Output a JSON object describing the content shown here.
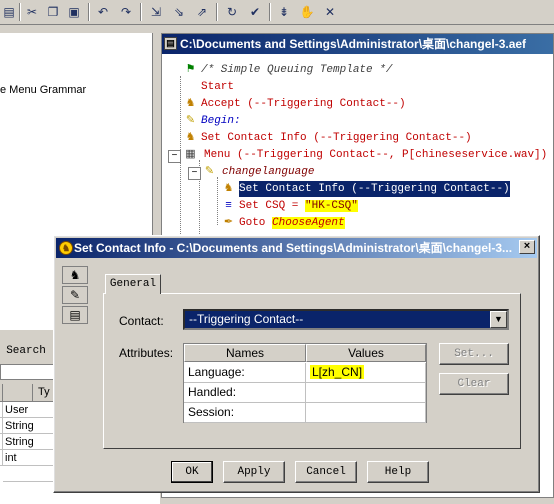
{
  "toolbar": {
    "buttons": [
      "save-icon",
      "cut-icon",
      "copy-icon",
      "paste-icon",
      "undo-icon",
      "redo-icon",
      "step-into-icon",
      "step-over-icon",
      "step-out-icon",
      "run-icon",
      "debug-icon",
      "breakpoint-icon",
      "stop-icon",
      "clear-icon"
    ]
  },
  "left_panel": {
    "grammar_text": "e Menu Grammar",
    "search_label": "Search",
    "table_header_type": "Ty",
    "rows": [
      {
        "value": "User"
      },
      {
        "value": "String"
      },
      {
        "value": "String"
      },
      {
        "value": "int"
      },
      {
        "value": ""
      }
    ]
  },
  "script_window": {
    "title": "C:\\Documents and Settings\\Administrator\\桌面\\changel-3.aef",
    "nodes": {
      "comment": "/* Simple Queuing Template */",
      "start": "Start",
      "accept": "Accept (--Triggering Contact--)",
      "begin": "Begin:",
      "set_contact_info": "Set Contact Info (--Triggering Contact--)",
      "menu": "Menu (--Triggering Contact--, P[chineseservice.wav])",
      "changelanguage": "changelanguage",
      "set_contact_info_sel": "Set Contact Info (--Triggering Contact--)",
      "set_csq_prefix": "Set CSQ = ",
      "set_csq_value": "\"HK-CSQ\"",
      "goto_prefix": "Goto ",
      "goto_target": "ChooseAgent"
    }
  },
  "dialog": {
    "title": "Set Contact Info - C:\\Documents and Settings\\Administrator\\桌面\\changel-3...",
    "tab_general": "General",
    "contact_label": "Contact:",
    "contact_value": "--Triggering Contact--",
    "attributes_label": "Attributes:",
    "grid": {
      "col_names": "Names",
      "col_values": "Values",
      "rows": [
        {
          "name": "Language:",
          "value": "L[zh_CN]"
        },
        {
          "name": "Handled:",
          "value": ""
        },
        {
          "name": "Session:",
          "value": ""
        }
      ]
    },
    "set_button": "Set...",
    "clear_button": "Clear",
    "ok_button": "OK",
    "apply_button": "Apply",
    "cancel_button": "Cancel",
    "help_button": "Help"
  },
  "colors": {
    "title_bar": "#0a246a",
    "highlight": "#ffff00",
    "selection": "#0a246a",
    "keyword": "#c00000"
  }
}
